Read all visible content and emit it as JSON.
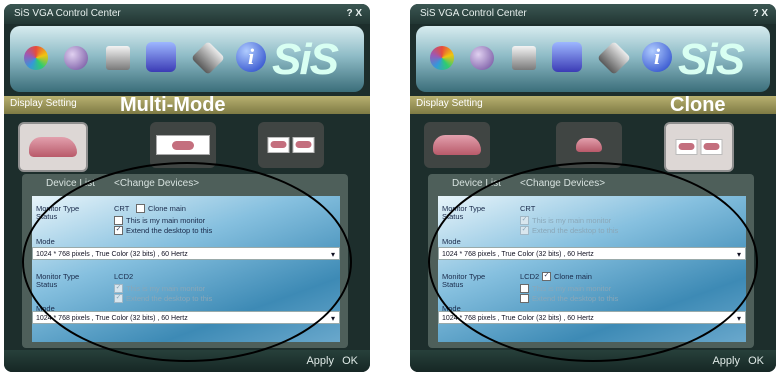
{
  "left": {
    "window_title": "SiS VGA Control Center",
    "title_controls": "? X",
    "display_setting": "Display Setting",
    "annotation": "Multi-Mode",
    "device_list": "Device List",
    "change_devices": "<Change Devices>",
    "monitor1": {
      "type_label": "Monitor Type",
      "status_label": "Status",
      "type": "CRT",
      "clone_main": "Clone main",
      "main_monitor": "This is my main monitor",
      "extend": "Extend the desktop to this",
      "mode_label": "Mode",
      "mode_value": "1024 * 768 pixels , True Color (32 bits) , 60 Hertz"
    },
    "monitor2": {
      "type_label": "Monitor Type",
      "status_label": "Status",
      "type": "LCD2",
      "main_monitor": "This is my main monitor",
      "extend": "Extend the desktop to this",
      "mode_label": "Mode",
      "mode_value": "1024 * 768 pixels , True Color (32 bits) , 60 Hertz"
    },
    "apply": "Apply",
    "ok": "OK",
    "logo": "SiS"
  },
  "right": {
    "window_title": "SiS VGA Control Center",
    "title_controls": "? X",
    "display_setting": "Display Setting",
    "annotation": "Clone",
    "device_list": "Device List",
    "change_devices": "<Change Devices>",
    "monitor1": {
      "type_label": "Monitor Type",
      "status_label": "Status",
      "type": "CRT",
      "main_monitor": "This is my main monitor",
      "extend": "Extend the desktop to this",
      "mode_label": "Mode",
      "mode_value": "1024 * 768 pixels , True Color (32 bits) , 60 Hertz"
    },
    "monitor2": {
      "type_label": "Monitor Type",
      "status_label": "Status",
      "type": "LCD2",
      "clone_main": "Clone main",
      "main_monitor": "This is my main monitor",
      "extend": "Extend the desktop to this",
      "mode_label": "Mode",
      "mode_value": "1024 * 768 pixels , True Color (32 bits) , 60 Hertz"
    },
    "apply": "Apply",
    "ok": "OK",
    "logo": "SiS"
  },
  "icons": [
    "color-icon",
    "tools-icon",
    "monitor-icon",
    "display-settings-icon",
    "diamond-icon",
    "info-icon"
  ],
  "colors": {
    "frame": "#1d2e2c",
    "accent_bar": "#9d9658",
    "panel": "#4e5f5a",
    "inner_gradient_mid": "#86c0df"
  }
}
